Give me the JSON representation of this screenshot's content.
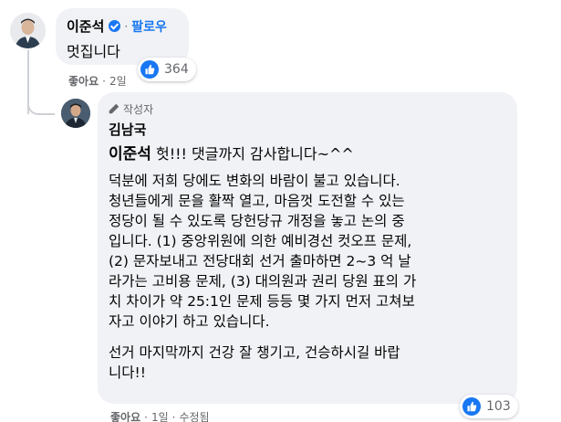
{
  "comment": {
    "author": "이준석",
    "follow_label": "팔로우",
    "dot": "·",
    "text": "멋집니다",
    "reaction_count": "364",
    "like_label": "좋아요",
    "time": "2일"
  },
  "reply": {
    "badge_label": "작성자",
    "author": "김남국",
    "mention": "이준석",
    "first_line": " 헛!!! 댓글까지 감사합니다~^^",
    "paragraph1_lines": [
      "덕분에 저희 당에도 변화의 바람이 불고 있습니다.",
      "청년들에게 문을 활짝 열고, 마음껏 도전할 수 있는",
      "정당이 될 수 있도록 당헌당규 개정을 놓고 논의 중",
      "입니다. (1) 중앙위원에 의한 예비경선 컷오프 문제,",
      "(2) 문자보내고 전당대회 선거 출마하면 2~3 억 날",
      "라가는 고비용 문제, (3) 대의원과 권리 당원 표의 가",
      "치 차이가 약 25:1인 문제 등등 몇 가지 먼저 고쳐보",
      "자고 이야기 하고 있습니다."
    ],
    "paragraph2_lines": [
      "선거 마지막까지 건강 잘 챙기고, 건승하시길 바랍",
      "니다!!"
    ],
    "reaction_count": "103",
    "like_label": "좋아요",
    "time": "1일",
    "edited_label": "수정됨",
    "dot": "·"
  },
  "colors": {
    "accent": "#1877f2",
    "bubble": "#f0f2f5",
    "meta": "#65676b"
  },
  "icons": {
    "verified": "verified-badge-icon",
    "like": "thumbs-up-icon",
    "author_badge": "pencil-icon"
  }
}
